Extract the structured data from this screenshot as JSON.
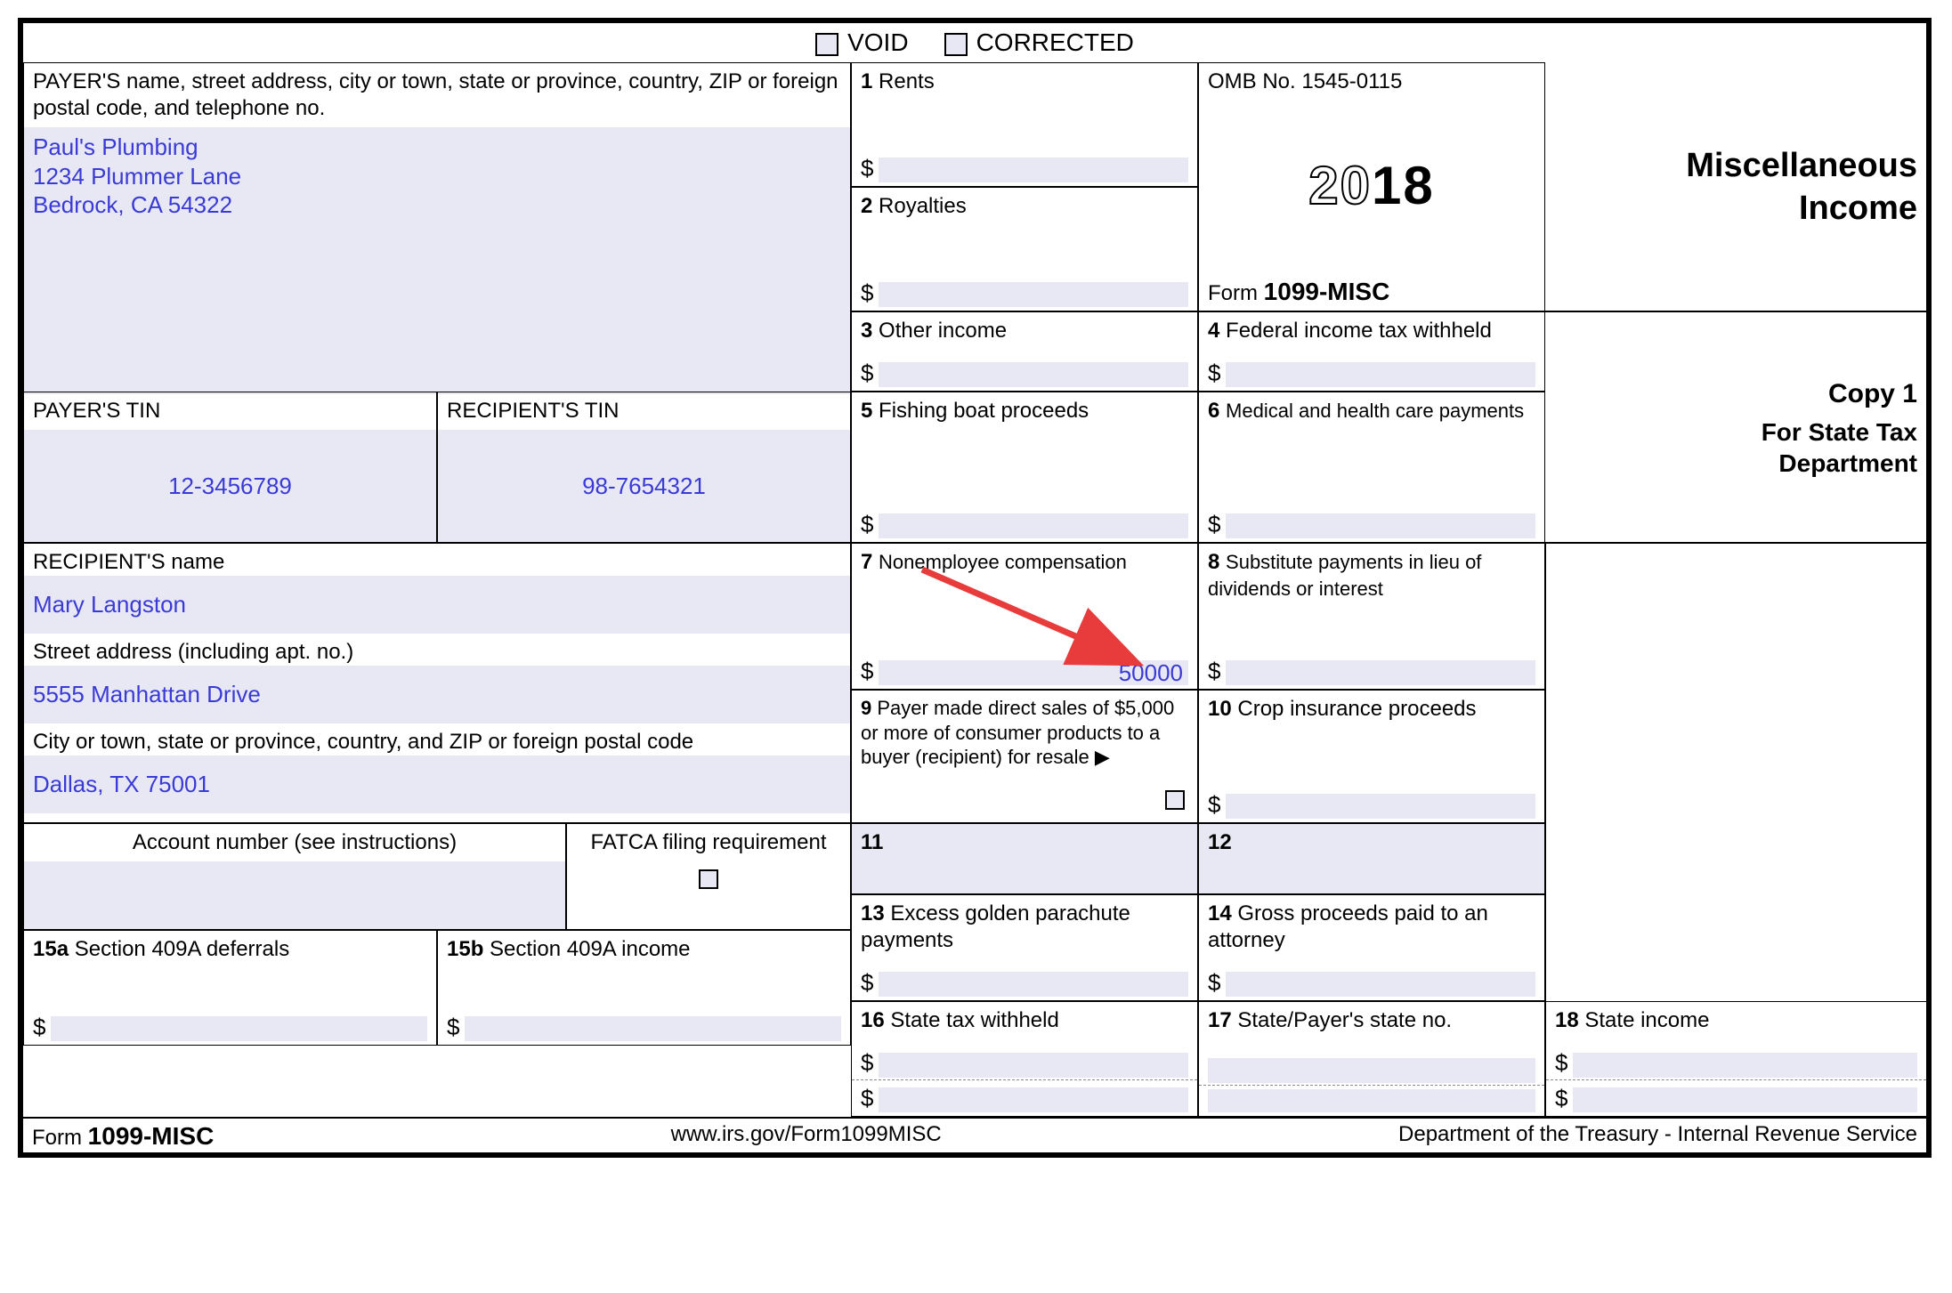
{
  "header": {
    "void": "VOID",
    "corrected": "CORRECTED"
  },
  "payer": {
    "label": "PAYER'S name, street address, city or town, state or province, country, ZIP or foreign postal code, and telephone no.",
    "name": "Paul's Plumbing",
    "addr1": "1234 Plummer Lane",
    "addr2": "Bedrock, CA 54322",
    "tin_label": "PAYER'S TIN",
    "tin": "12-3456789"
  },
  "recipient": {
    "tin_label": "RECIPIENT'S TIN",
    "tin": "98-7654321",
    "name_label": "RECIPIENT'S name",
    "name": "Mary Langston",
    "street_label": "Street address (including apt. no.)",
    "street": "5555 Manhattan Drive",
    "city_label": "City or town, state or province, country, and ZIP or foreign postal code",
    "city": "Dallas, TX 75001",
    "acct_label": "Account number (see instructions)",
    "fatca_label": "FATCA filing requirement"
  },
  "boxes": {
    "b1": "Rents",
    "b2": "Royalties",
    "b3": "Other income",
    "b4": "Federal income tax withheld",
    "b5": "Fishing boat proceeds",
    "b6": "Medical and health care payments",
    "b7": "Nonemployee compensation",
    "b7_value": "50000",
    "b8": "Substitute payments in lieu of dividends or interest",
    "b9": "Payer made direct sales of $5,000 or more of consumer products to a buyer (recipient) for resale ▶",
    "b10": "Crop insurance proceeds",
    "b11": "",
    "b12": "",
    "b13": "Excess golden parachute payments",
    "b14": "Gross proceeds paid to an attorney",
    "b15a": "Section 409A deferrals",
    "b15b": "Section 409A income",
    "b16": "State tax withheld",
    "b17": "State/Payer's state no.",
    "b18": "State income"
  },
  "meta": {
    "omb": "OMB No. 1545-0115",
    "year": "2018",
    "year_prefix": "20",
    "year_suffix": "18",
    "form_label": "Form",
    "form_num": "1099-MISC",
    "title1": "Miscellaneous",
    "title2": "Income",
    "copy": "Copy 1",
    "for_state1": "For State Tax",
    "for_state2": "Department"
  },
  "footer": {
    "form": "Form",
    "num": "1099-MISC",
    "url": "www.irs.gov/Form1099MISC",
    "dept": "Department of the Treasury - Internal Revenue Service"
  }
}
